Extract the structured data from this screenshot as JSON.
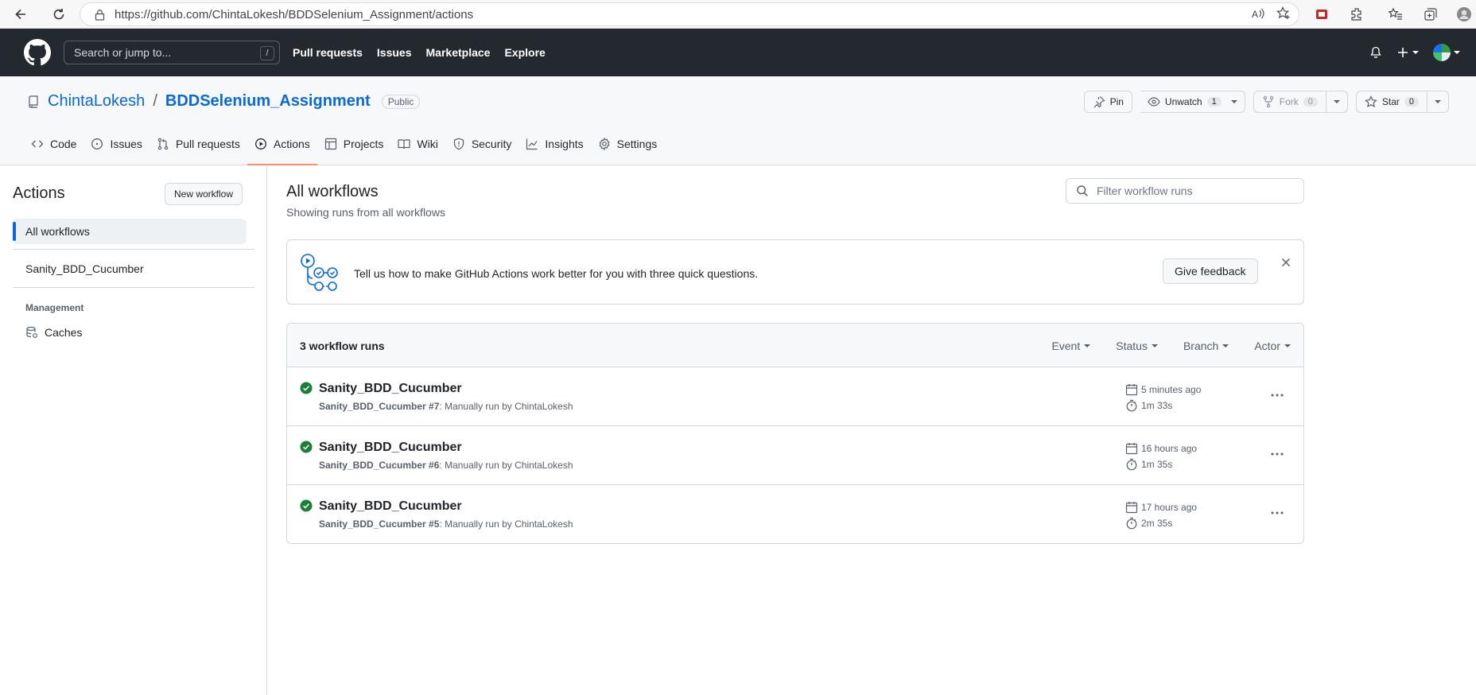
{
  "browser": {
    "url": "https://github.com/ChintaLokesh/BDDSelenium_Assignment/actions"
  },
  "header": {
    "search_placeholder": "Search or jump to...",
    "search_shortcut": "/",
    "nav": [
      "Pull requests",
      "Issues",
      "Marketplace",
      "Explore"
    ]
  },
  "repo": {
    "owner": "ChintaLokesh",
    "separator": "/",
    "name": "BDDSelenium_Assignment",
    "visibility": "Public",
    "pin_label": "Pin",
    "watch_label": "Unwatch",
    "watch_count": "1",
    "fork_label": "Fork",
    "fork_count": "0",
    "star_label": "Star",
    "star_count": "0",
    "tabs": [
      {
        "label": "Code",
        "icon": "code-icon"
      },
      {
        "label": "Issues",
        "icon": "issue-icon"
      },
      {
        "label": "Pull requests",
        "icon": "pull-request-icon"
      },
      {
        "label": "Actions",
        "icon": "play-icon",
        "active": true
      },
      {
        "label": "Projects",
        "icon": "table-icon"
      },
      {
        "label": "Wiki",
        "icon": "book-icon"
      },
      {
        "label": "Security",
        "icon": "shield-icon"
      },
      {
        "label": "Insights",
        "icon": "graph-icon"
      },
      {
        "label": "Settings",
        "icon": "gear-icon"
      }
    ]
  },
  "sidebar": {
    "title": "Actions",
    "new_workflow": "New workflow",
    "all_workflows": "All workflows",
    "workflow": "Sanity_BDD_Cucumber",
    "management_title": "Management",
    "caches": "Caches"
  },
  "main": {
    "title": "All workflows",
    "subtitle": "Showing runs from all workflows",
    "filter_placeholder": "Filter workflow runs",
    "feedback_text": "Tell us how to make GitHub Actions work better for you with three quick questions.",
    "feedback_button": "Give feedback",
    "runs_count": "3 workflow runs",
    "filters": [
      "Event",
      "Status",
      "Branch",
      "Actor"
    ],
    "runs": [
      {
        "name": "Sanity_BDD_Cucumber",
        "workflow": "Sanity_BDD_Cucumber",
        "number": "#7",
        "detail": ": Manually run by ChintaLokesh",
        "time": "5 minutes ago",
        "duration": "1m 33s"
      },
      {
        "name": "Sanity_BDD_Cucumber",
        "workflow": "Sanity_BDD_Cucumber",
        "number": "#6",
        "detail": ": Manually run by ChintaLokesh",
        "time": "16 hours ago",
        "duration": "1m 35s"
      },
      {
        "name": "Sanity_BDD_Cucumber",
        "workflow": "Sanity_BDD_Cucumber",
        "number": "#5",
        "detail": ": Manually run by ChintaLokesh",
        "time": "17 hours ago",
        "duration": "2m 35s"
      }
    ]
  },
  "colors": {
    "accent": "#0969da",
    "success": "#1a7f37",
    "header_bg": "#24292f",
    "active_tab_underline": "#fd8c73"
  }
}
